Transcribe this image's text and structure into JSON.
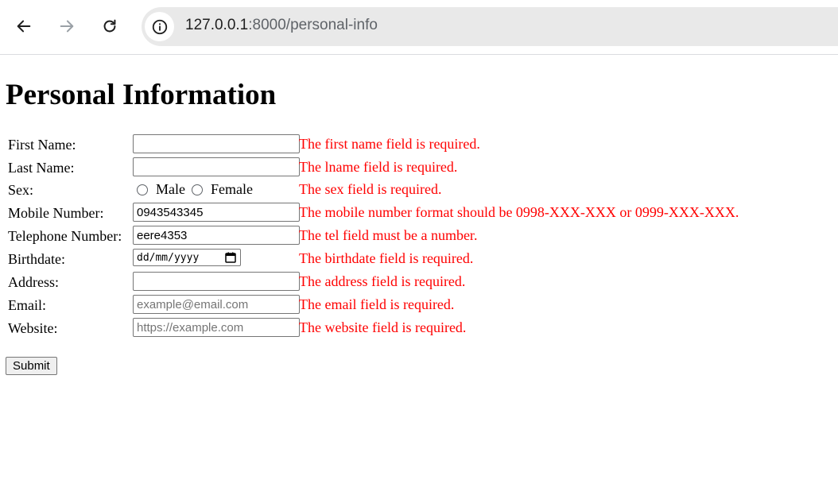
{
  "browser": {
    "url_host": "127.0.0.1",
    "url_rest": ":8000/personal-info"
  },
  "page": {
    "title": "Personal Information"
  },
  "form": {
    "first_name": {
      "label": "First Name:",
      "value": "",
      "error": "The first name field is required."
    },
    "last_name": {
      "label": "Last Name:",
      "value": "",
      "error": "The lname field is required."
    },
    "sex": {
      "label": "Sex:",
      "options": [
        "Male",
        "Female"
      ],
      "error": "The sex field is required."
    },
    "mobile": {
      "label": "Mobile Number:",
      "value": "0943543345",
      "error": "The mobile number format should be 0998-XXX-XXX or 0999-XXX-XXX."
    },
    "telephone": {
      "label": "Telephone Number:",
      "value": "eere4353",
      "error": "The tel field must be a number."
    },
    "birthdate": {
      "label": "Birthdate:",
      "placeholder": "dd/mm/yyyy",
      "error": "The birthdate field is required."
    },
    "address": {
      "label": "Address:",
      "value": "",
      "error": "The address field is required."
    },
    "email": {
      "label": "Email:",
      "placeholder": "example@email.com",
      "error": "The email field is required."
    },
    "website": {
      "label": "Website:",
      "placeholder": "https://example.com",
      "error": "The website field is required."
    },
    "submit_label": "Submit"
  },
  "colors": {
    "error": "#ff0000"
  }
}
